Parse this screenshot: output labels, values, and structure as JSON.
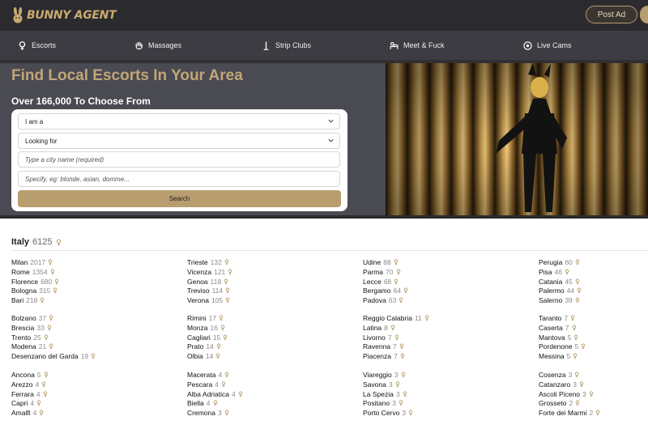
{
  "header": {
    "logo_text": "BUNNY AGENT",
    "post_ad_label": "Post Ad"
  },
  "nav": [
    {
      "label": "Escorts",
      "icon": "female-icon"
    },
    {
      "label": "Massages",
      "icon": "hand-icon"
    },
    {
      "label": "Strip Clubs",
      "icon": "pole-icon"
    },
    {
      "label": "Meet & Fuck",
      "icon": "bed-icon"
    },
    {
      "label": "Live Cams",
      "icon": "webcam-icon"
    }
  ],
  "hero": {
    "title": "Find Local Escorts In Your Area",
    "subtitle": "Over 166,000 To Choose From",
    "form": {
      "i_am_label": "I am a",
      "looking_for_label": "Looking for",
      "city_placeholder": "Type a city name (required)",
      "specify_placeholder": "Specify, eg: blonde, asian, domme...",
      "search_label": "Search"
    }
  },
  "section": {
    "country": "Italy",
    "count": "6125"
  },
  "colors": {
    "accent": "#b89d6e",
    "title_gold": "#c1a678",
    "nav_bg": "#3c3c42",
    "top_bg": "#2b2b2f"
  },
  "cities": [
    [
      [
        [
          "Milan",
          "2017"
        ],
        [
          "Rome",
          "1354"
        ],
        [
          "Florence",
          "680"
        ],
        [
          "Bologna",
          "315"
        ],
        [
          "Bari",
          "218"
        ]
      ],
      [
        [
          "Bolzano",
          "37"
        ],
        [
          "Brescia",
          "33"
        ],
        [
          "Trento",
          "25"
        ],
        [
          "Modena",
          "21"
        ],
        [
          "Desenzano del Garda",
          "19"
        ]
      ],
      [
        [
          "Ancona",
          "5"
        ],
        [
          "Arezzo",
          "4"
        ],
        [
          "Ferrara",
          "4"
        ],
        [
          "Capri",
          "4"
        ],
        [
          "Amalfi",
          "4"
        ]
      ]
    ],
    [
      [
        [
          "Trieste",
          "132"
        ],
        [
          "Vicenza",
          "121"
        ],
        [
          "Genoa",
          "118"
        ],
        [
          "Treviso",
          "114"
        ],
        [
          "Verona",
          "105"
        ]
      ],
      [
        [
          "Rimini",
          "17"
        ],
        [
          "Monza",
          "16"
        ],
        [
          "Cagliari",
          "15"
        ],
        [
          "Prato",
          "14"
        ],
        [
          "Olbia",
          "14"
        ]
      ],
      [
        [
          "Macerata",
          "4"
        ],
        [
          "Pescara",
          "4"
        ],
        [
          "Alba Adriatica",
          "4"
        ],
        [
          "Biella",
          "4"
        ],
        [
          "Cremona",
          "3"
        ]
      ]
    ],
    [
      [
        [
          "Udine",
          "88"
        ],
        [
          "Parma",
          "70"
        ],
        [
          "Lecce",
          "68"
        ],
        [
          "Bergamo",
          "64"
        ],
        [
          "Padova",
          "63"
        ]
      ],
      [
        [
          "Reggio Calabria",
          "11"
        ],
        [
          "Latina",
          "8"
        ],
        [
          "Livorno",
          "7"
        ],
        [
          "Ravenna",
          "7"
        ],
        [
          "Piacenza",
          "7"
        ]
      ],
      [
        [
          "Viareggio",
          "3"
        ],
        [
          "Savona",
          "3"
        ],
        [
          "La Spezia",
          "3"
        ],
        [
          "Positano",
          "3"
        ],
        [
          "Porto Cervo",
          "3"
        ]
      ]
    ],
    [
      [
        [
          "Perugia",
          "60"
        ],
        [
          "Pisa",
          "46"
        ],
        [
          "Catania",
          "45"
        ],
        [
          "Palermo",
          "44"
        ],
        [
          "Salerno",
          "39"
        ]
      ],
      [
        [
          "Taranto",
          "7"
        ],
        [
          "Caserta",
          "7"
        ],
        [
          "Mantova",
          "5"
        ],
        [
          "Pordenone",
          "5"
        ],
        [
          "Messina",
          "5"
        ]
      ],
      [
        [
          "Cosenza",
          "3"
        ],
        [
          "Catanzaro",
          "3"
        ],
        [
          "Ascoli Piceno",
          "3"
        ],
        [
          "Grosseto",
          "2"
        ],
        [
          "Forte dei Marmi",
          "2"
        ]
      ]
    ]
  ]
}
